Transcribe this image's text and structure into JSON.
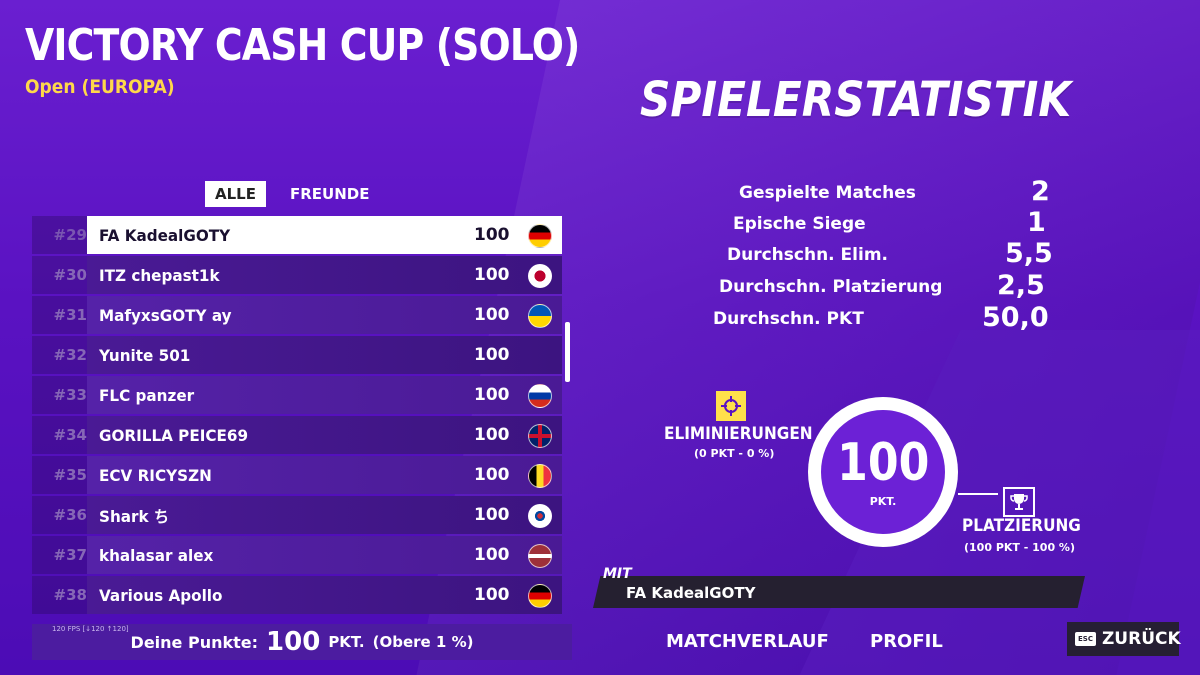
{
  "header": {
    "title": "VICTORY CASH CUP (SOLO)",
    "subtitle": "Open (EUROPA)",
    "stats_title": "SPIELERSTATISTIK"
  },
  "tabs": [
    {
      "label": "ALLE",
      "active": true
    },
    {
      "label": "FREUNDE",
      "active": false
    }
  ],
  "leaderboard": [
    {
      "rank": "#29",
      "name": "FA KadealGOTY",
      "points": "100",
      "flag": "germany-flag",
      "self": true
    },
    {
      "rank": "#30",
      "name": "ITZ chepast1k",
      "points": "100",
      "flag": "japan-flag"
    },
    {
      "rank": "#31",
      "name": "MafyxsGOTY ay",
      "points": "100",
      "flag": "ukraine-flag"
    },
    {
      "rank": "#32",
      "name": "Yunite 501",
      "points": "100",
      "flag": ""
    },
    {
      "rank": "#33",
      "name": "FLC panzer",
      "points": "100",
      "flag": "russia-flag"
    },
    {
      "rank": "#34",
      "name": "GORILLA PEICE69",
      "points": "100",
      "flag": "uk-flag"
    },
    {
      "rank": "#35",
      "name": "ECV RICYSZN",
      "points": "100",
      "flag": "belgium-flag"
    },
    {
      "rank": "#36",
      "name": "Shark ち",
      "points": "100",
      "flag": "south-korea-flag"
    },
    {
      "rank": "#37",
      "name": "khalasar alex",
      "points": "100",
      "flag": "latvia-flag"
    },
    {
      "rank": "#38",
      "name": "Various Apollo",
      "points": "100",
      "flag": "germany-flag"
    }
  ],
  "footer": {
    "label": "Deine Punkte:",
    "points": "100",
    "unit": "PKT.",
    "rank_note": "(Obere 1 %)",
    "fps": "120 FPS [↓120 ↑120]"
  },
  "stats": [
    {
      "label": "Gespielte Matches",
      "value": "2"
    },
    {
      "label": "Epische Siege",
      "value": "1"
    },
    {
      "label": "Durchschn. Elim.",
      "value": "5,5"
    },
    {
      "label": "Durchschn. Platzierung",
      "value": "2,5"
    },
    {
      "label": "Durchschn. PKT",
      "value": "50,0"
    }
  ],
  "score_ring": {
    "value": "100",
    "unit": "PKT."
  },
  "eliminations": {
    "label": "ELIMINIERUNGEN",
    "detail": "(0 PKT - 0 %)",
    "icon": "crosshair-icon"
  },
  "placement": {
    "label": "PLATZIERUNG",
    "detail": "(100 PKT - 100 %)",
    "icon": "trophy-icon"
  },
  "with": {
    "label": "MIT",
    "name": "FA KadealGOTY"
  },
  "nav": {
    "history": "MATCHVERLAUF",
    "profile": "PROFIL",
    "back_key": "ESC",
    "back": "ZURÜCK"
  },
  "colors": {
    "background": "#5a12c2",
    "accent_yellow": "#ffd84a",
    "row_dark": "#3c1480"
  }
}
